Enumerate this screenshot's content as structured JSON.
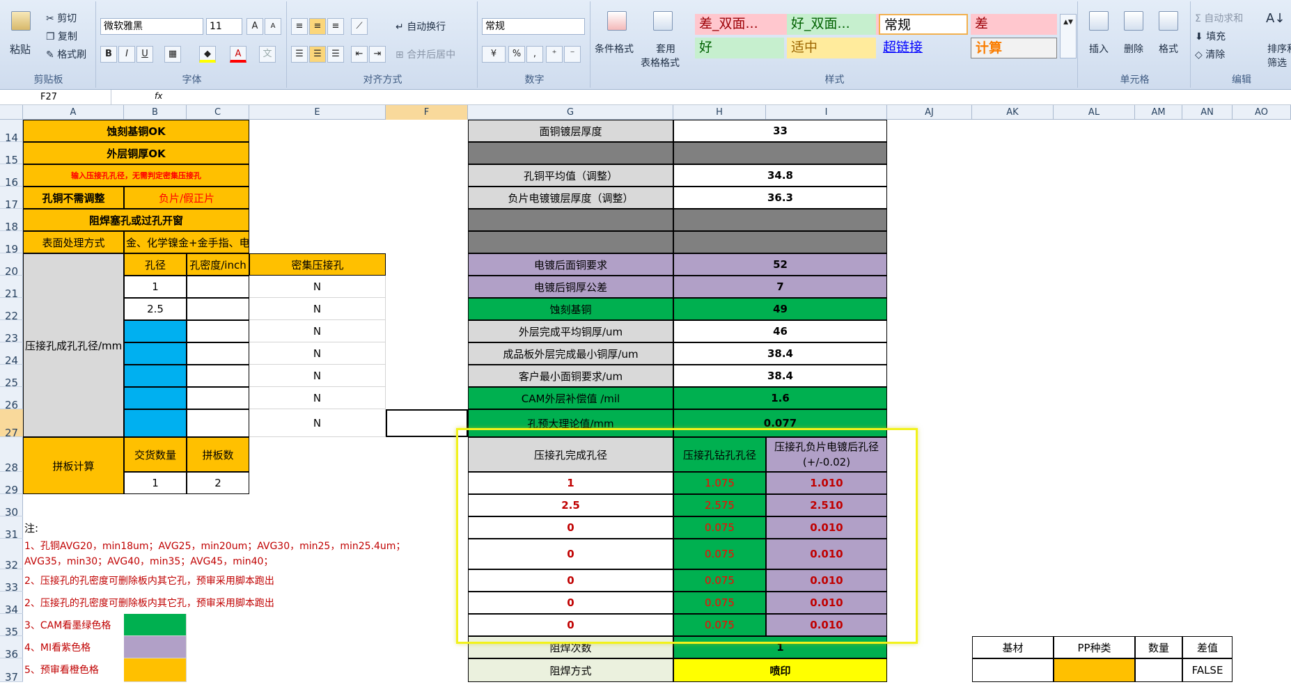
{
  "ribbon": {
    "clipboard": {
      "paste": "粘贴",
      "cut": "剪切",
      "copy": "复制",
      "format_painter": "格式刷",
      "label": "剪贴板"
    },
    "font": {
      "name": "微软雅黑",
      "size": "11",
      "label": "字体",
      "bold": "B",
      "italic": "I",
      "underline": "U",
      "grow": "A",
      "shrink": "A"
    },
    "align": {
      "wrap": "自动换行",
      "merge": "合并后居中",
      "label": "对齐方式"
    },
    "number": {
      "format": "常规",
      "percent": "%",
      "comma": ",",
      "label": "数字"
    },
    "styles": {
      "cond": "条件格式",
      "table_l1": "套用",
      "table_l2": "表格格式",
      "label": "样式",
      "cells": [
        "差_双面...",
        "好_双面...",
        "常规",
        "差",
        "好",
        "适中",
        "超链接",
        "计算"
      ]
    },
    "cells": {
      "insert": "插入",
      "delete": "删除",
      "format": "格式",
      "label": "单元格"
    },
    "edit": {
      "autosum": "自动求和",
      "fill": "填充",
      "clear": "清除",
      "sort_l1": "排序和",
      "sort_l2": "筛选",
      "label": "编辑"
    }
  },
  "formula_bar": {
    "name_box": "F27",
    "fx": "fx",
    "content": ""
  },
  "columns": [
    "A",
    "B",
    "C",
    "E",
    "F",
    "G",
    "H",
    "I",
    "AJ",
    "AK",
    "AL",
    "AM",
    "AN",
    "AO"
  ],
  "rows": [
    "14",
    "15",
    "16",
    "17",
    "18",
    "19",
    "20",
    "21",
    "22",
    "23",
    "24",
    "25",
    "26",
    "27",
    "28",
    "29",
    "30",
    "31",
    "32",
    "33",
    "34",
    "35",
    "36",
    "37"
  ],
  "left": {
    "a14": "蚀刻基铜OK",
    "a15": "外层铜厚OK",
    "a16": "输入压接孔孔径，无需判定密集压接孔",
    "a17": "孔铜不需调整",
    "b17": "负片/假正片",
    "a18": "阻焊塞孔或过孔开窗",
    "a19": "表面处理方式",
    "b19": "金、化学镍金+金手指、电",
    "a20": "压接孔成孔孔径/mm",
    "b20": "孔径",
    "c20": "孔密度/inch",
    "e20": "密集压接孔",
    "b21": "1",
    "b22": "2.5",
    "e_vals": [
      "N",
      "N",
      "N",
      "N",
      "N",
      "N",
      "N"
    ],
    "a28": "拼板计算",
    "b28": "交货数量",
    "c28": "拼板数",
    "b29": "1",
    "c29": "2"
  },
  "notes": {
    "title": "注:",
    "n1a": "1、孔铜AVG20，min18um；AVG25，min20um；AVG30，min25，min25.4um；",
    "n1b": "AVG35，min30；AVG40，min35；AVG45，min40；",
    "n2": "2、压接孔的孔密度可删除板内其它孔，预审采用脚本跑出",
    "n3": "2、压接孔的孔密度可删除板内其它孔，预审采用脚本跑出",
    "n4": "3、CAM看墨绿色格",
    "n5": "4、MI看紫色格",
    "n6": "5、预审看橙色格"
  },
  "params": [
    {
      "label": "面铜镀层厚度",
      "value": "33"
    },
    {
      "label": "孔铜平均值（调整）",
      "value": "34.8"
    },
    {
      "label": "负片电镀镀层厚度（调整）",
      "value": "36.3"
    },
    {
      "label": "电镀后面铜要求",
      "value": "52"
    },
    {
      "label": "电镀后铜厚公差",
      "value": "7"
    },
    {
      "label": "蚀刻基铜",
      "value": "49"
    },
    {
      "label": "外层完成平均铜厚/um",
      "value": "46"
    },
    {
      "label": "成品板外层完成最小铜厚/um",
      "value": "38.4"
    },
    {
      "label": "客户最小面铜要求/um",
      "value": "38.4"
    },
    {
      "label": "CAM外层补偿值 /mil",
      "value": "1.6"
    },
    {
      "label": "孔预大理论值/mm",
      "value": "0.077"
    }
  ],
  "press_table": {
    "headers": [
      "压接孔完成孔径",
      "压接孔钻孔孔径",
      "压接孔负片电镀后孔径",
      "(+/-0.02)"
    ],
    "rows": [
      [
        "1",
        "1.075",
        "1.010"
      ],
      [
        "2.5",
        "2.575",
        "2.510"
      ],
      [
        "0",
        "0.075",
        "0.010"
      ],
      [
        "0",
        "0.075",
        "0.010"
      ],
      [
        "0",
        "0.075",
        "0.010"
      ],
      [
        "0",
        "0.075",
        "0.010"
      ],
      [
        "0",
        "0.075",
        "0.010"
      ]
    ]
  },
  "solder": {
    "times_label": "阻焊次数",
    "times": "1",
    "method_label": "阻焊方式",
    "method": "喷印"
  },
  "right_table": {
    "headers": [
      "基材",
      "PP种类",
      "数量",
      "差值"
    ],
    "diff": "FALSE"
  }
}
